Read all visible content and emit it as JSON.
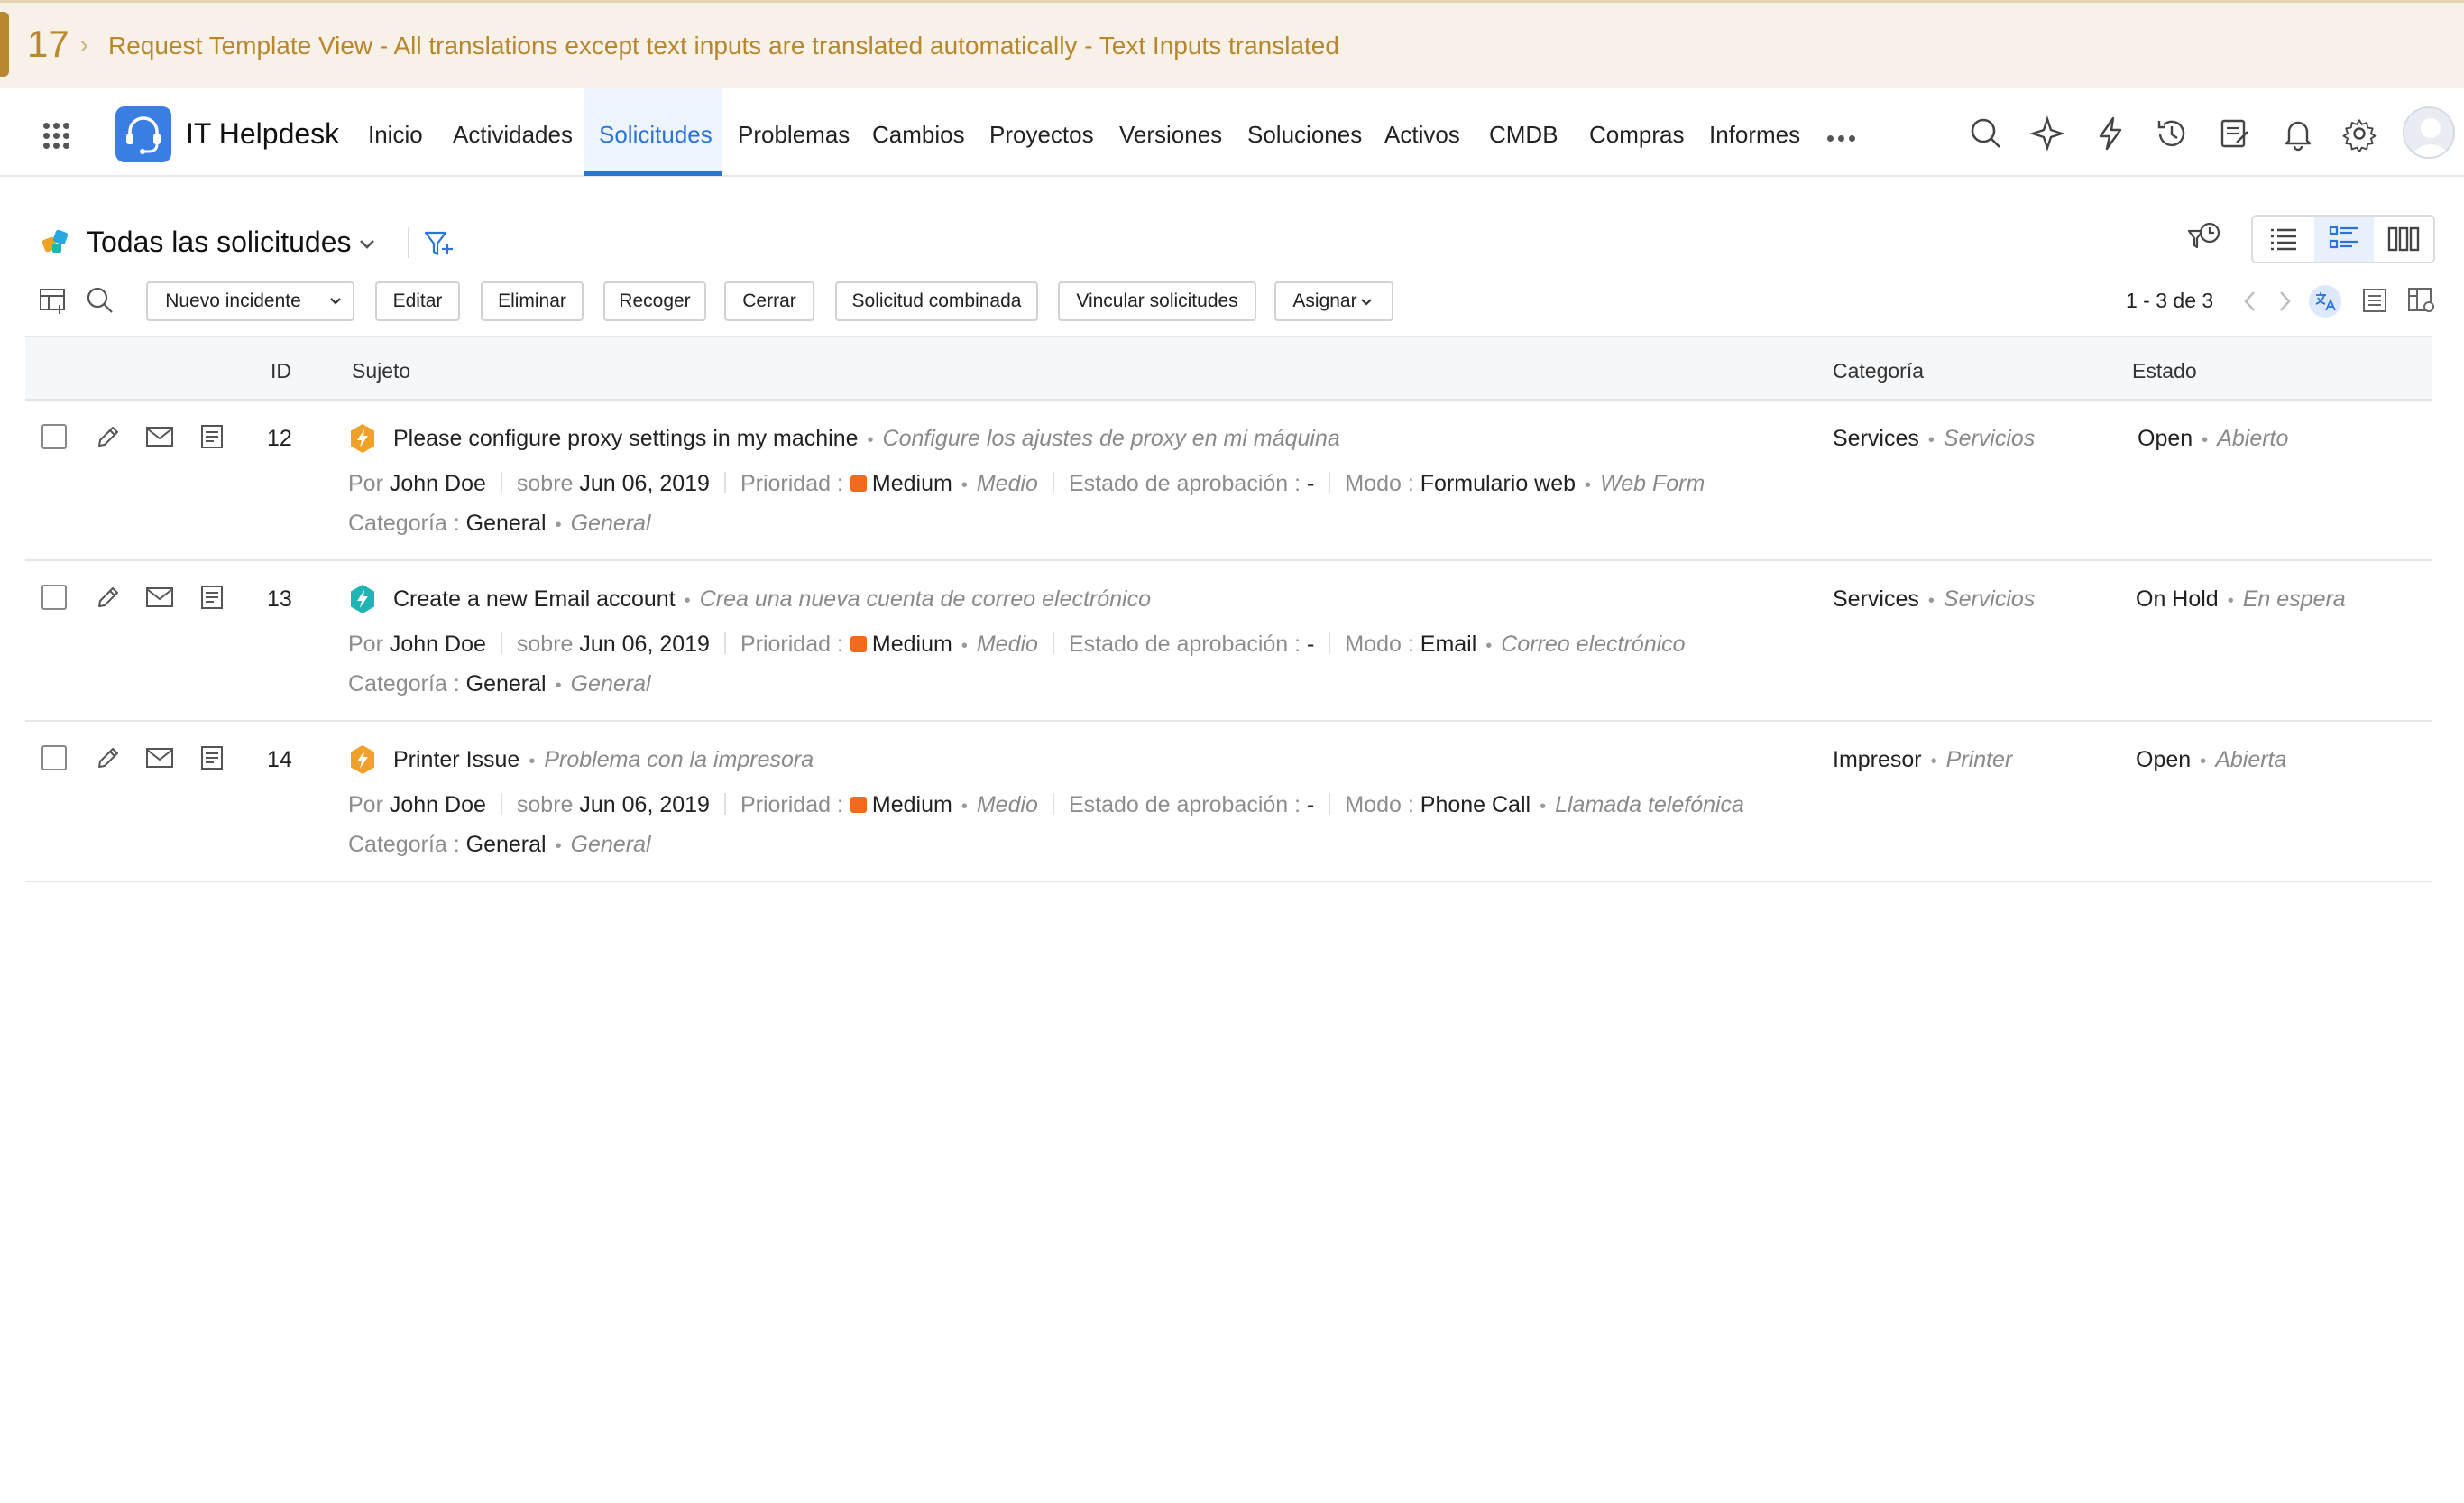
{
  "banner": {
    "number": "17",
    "text": "Request Template View - All translations except text inputs are translated automatically  - Text Inputs translated"
  },
  "app": {
    "title": "IT Helpdesk"
  },
  "nav": {
    "items": [
      {
        "label": "Inicio"
      },
      {
        "label": "Actividades"
      },
      {
        "label": "Solicitudes",
        "active": true
      },
      {
        "label": "Problemas"
      },
      {
        "label": "Cambios"
      },
      {
        "label": "Proyectos"
      },
      {
        "label": "Versiones"
      },
      {
        "label": "Soluciones"
      },
      {
        "label": "Activos"
      },
      {
        "label": "CMDB"
      },
      {
        "label": "Compras"
      },
      {
        "label": "Informes"
      }
    ],
    "icons": [
      "search-icon",
      "ai-sparkle-icon",
      "lightning-icon",
      "history-icon",
      "notes-icon",
      "bell-icon",
      "gear-icon"
    ]
  },
  "view": {
    "title": "Todas las solicitudes"
  },
  "toolbar": {
    "new_incident": "Nuevo incidente",
    "edit": "Editar",
    "delete": "Eliminar",
    "pickup": "Recoger",
    "close": "Cerrar",
    "merge": "Solicitud combinada",
    "link": "Vincular solicitudes",
    "assign": "Asignar",
    "pager": "1 - 3 de 3"
  },
  "table": {
    "headers": {
      "id": "ID",
      "subject": "Sujeto",
      "category": "Categoría",
      "status": "Estado"
    },
    "labels": {
      "by": "Por",
      "on": "sobre",
      "priority": "Prioridad :",
      "approval": "Estado de aprobación :",
      "approval_value": "-",
      "mode": "Modo :",
      "category": "Categoría :"
    },
    "rows": [
      {
        "id": "12",
        "subject": "Please configure proxy settings in my machine",
        "subject_tr": "Configure los ajustes de proxy en mi máquina",
        "requester": "John Doe",
        "date": "Jun 06, 2019",
        "priority": "Medium",
        "priority_tr": "Medio",
        "mode": "Formulario web",
        "mode_tr": "Web Form",
        "category_line": "General",
        "category_line_tr": "General",
        "category": "Services",
        "category_tr": "Servicios",
        "status": "Open",
        "status_tr": "Abierto",
        "icon_color": "#f0a12a"
      },
      {
        "id": "13",
        "subject": "Create a new Email account",
        "subject_tr": "Crea una nueva cuenta de correo electrónico",
        "requester": "John Doe",
        "date": "Jun 06, 2019",
        "priority": "Medium",
        "priority_tr": "Medio",
        "mode": "Email",
        "mode_tr": "Correo electrónico",
        "category_line": "General",
        "category_line_tr": "General",
        "category": "Services",
        "category_tr": "Servicios",
        "status": "On Hold",
        "status_tr": "En espera",
        "icon_color": "#1fb5b5"
      },
      {
        "id": "14",
        "subject": "Printer Issue",
        "subject_tr": "Problema con la impresora",
        "requester": "John Doe",
        "date": "Jun 06, 2019",
        "priority": "Medium",
        "priority_tr": "Medio",
        "mode": "Phone Call",
        "mode_tr": "Llamada telefónica",
        "category_line": "General",
        "category_line_tr": "General",
        "category": "Impresor",
        "category_tr": "Printer",
        "status": "Open",
        "status_tr": "Abierta",
        "icon_color": "#f0a12a"
      }
    ]
  },
  "colors": {
    "accent": "#2a73d9",
    "priority_medium": "#f26b1d",
    "banner_text": "#b8862c"
  }
}
